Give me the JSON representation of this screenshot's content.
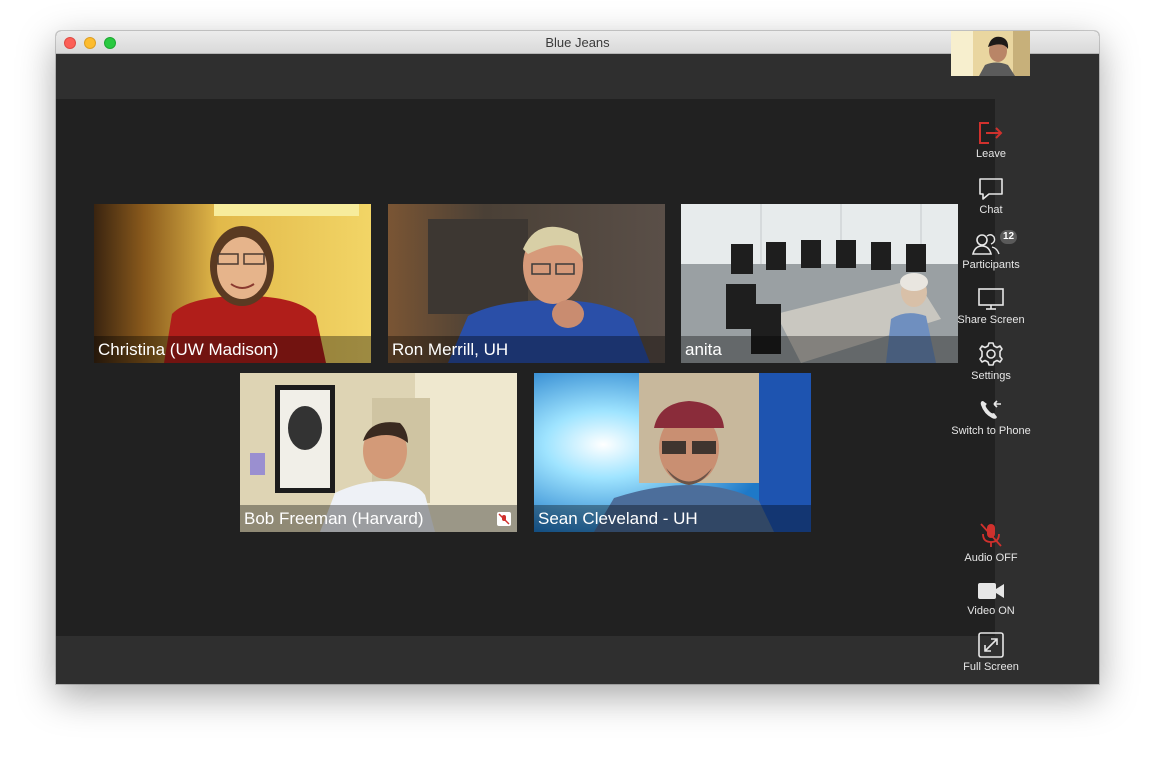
{
  "window": {
    "title": "Blue Jeans"
  },
  "participants_tiles": [
    {
      "name": "Christina (UW Madison)"
    },
    {
      "name": "Ron Merrill, UH"
    },
    {
      "name": "anita"
    },
    {
      "name": "Bob Freeman (Harvard)"
    },
    {
      "name": "Sean Cleveland - UH"
    }
  ],
  "controls": {
    "leave": {
      "label": "Leave",
      "icon": "leave-icon",
      "color": "#d0312d"
    },
    "chat": {
      "label": "Chat",
      "icon": "chat-icon"
    },
    "participants": {
      "label": "Participants",
      "icon": "participants-icon",
      "count": "12"
    },
    "share_screen": {
      "label": "Share Screen",
      "icon": "monitor-icon"
    },
    "settings": {
      "label": "Settings",
      "icon": "gear-icon"
    },
    "switch_to_phone": {
      "label": "Switch to Phone",
      "icon": "phone-icon"
    },
    "audio": {
      "label": "Audio OFF",
      "icon": "microphone-muted-icon",
      "color": "#d0312d"
    },
    "video": {
      "label": "Video ON",
      "icon": "video-camera-icon"
    },
    "fullscreen": {
      "label": "Full Screen",
      "icon": "fullscreen-icon"
    }
  }
}
